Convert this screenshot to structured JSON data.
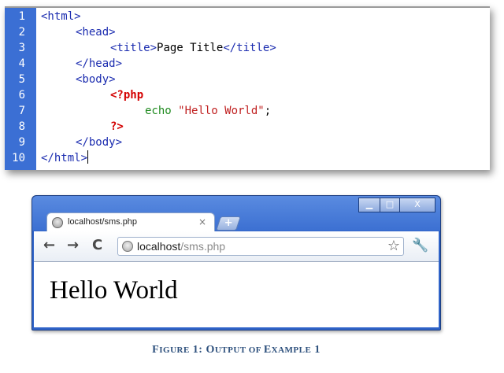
{
  "editor": {
    "line_numbers": [
      "1",
      "2",
      "3",
      "4",
      "5",
      "6",
      "7",
      "8",
      "9",
      "10"
    ],
    "lines": {
      "l1": "<html>",
      "l2": "<head>",
      "l3_open": "<title>",
      "l3_text": "Page Title",
      "l3_close": "</title>",
      "l4": "</head>",
      "l5": "<body>",
      "l6": "<?php",
      "l7_kw": "echo",
      "l7_str": "\"Hello World\"",
      "l7_end": ";",
      "l8": "?>",
      "l9": "</body>",
      "l10": "</html>"
    },
    "colors": {
      "gutter": "#3b6fd4",
      "tag": "#1c2db0",
      "php": "#d40000",
      "keyword": "#1f8a1f",
      "string": "#c02020"
    }
  },
  "browser": {
    "tab_title": "localhost/sms.php",
    "tab_close": "×",
    "new_tab": "+",
    "window_buttons": {
      "minimize": "▁",
      "maximize": "□",
      "close": "X"
    },
    "nav": {
      "back": "←",
      "forward": "→",
      "reload": "C"
    },
    "address": {
      "host": "localhost",
      "path": "/sms.php"
    },
    "bookmark_icon": "☆",
    "menu_icon": "🔧",
    "page_content": "Hello World",
    "colors": {
      "frame": "#2f63c8"
    }
  },
  "caption": {
    "f1": "F",
    "r1": "IGURE",
    "num": " 1: ",
    "f2": "O",
    "r2": "UTPUT OF ",
    "f3": "E",
    "r3": "XAMPLE",
    "end": " 1"
  }
}
